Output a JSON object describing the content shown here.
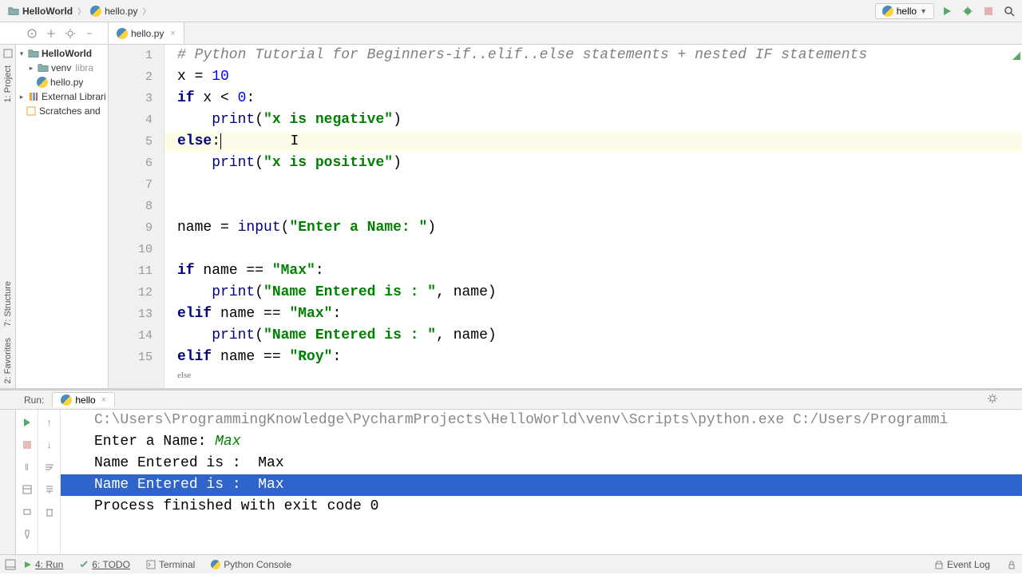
{
  "breadcrumb": {
    "project": "HelloWorld",
    "file": "hello.py"
  },
  "runConfig": {
    "name": "hello"
  },
  "tab": {
    "filename": "hello.py"
  },
  "tree": {
    "root": "HelloWorld",
    "venv": "venv",
    "venvSuffix": "libra",
    "hello": "hello.py",
    "ext": "External Librari",
    "scratch": "Scratches and"
  },
  "sideTabs": {
    "project": "1: Project",
    "structure": "7: Structure",
    "favorites": "2: Favorites"
  },
  "code": {
    "comment": "# Python Tutorial for Beginners-if..elif..else statements + nested IF statements",
    "x_assign_lhs": "x = ",
    "x_assign_val": "10",
    "if_kw": "if",
    "if_cond": " x < ",
    "zero": "0",
    "colon": ":",
    "print": "print",
    "str_neg": "\"x is negative\"",
    "else_kw": "else",
    "str_pos": "\"x is positive\"",
    "name_assign": "name = ",
    "input": "input",
    "str_prompt": "\"Enter a Name: \"",
    "if_name": " name == ",
    "str_max": "\"Max\"",
    "str_name_entered": "\"Name Entered is : \"",
    "comma_name": ", name)",
    "elif_kw": "elif",
    "str_roy": "\"Roy\"",
    "crumb": "else"
  },
  "run": {
    "title": "Run:",
    "tab": "hello",
    "line1": "C:\\Users\\ProgrammingKnowledge\\PycharmProjects\\HelloWorld\\venv\\Scripts\\python.exe C:/Users/Programmi",
    "prompt": "Enter a Name: ",
    "input": "Max",
    "out1": "Name Entered is :  Max",
    "out2": "Name Entered is :  Max",
    "exit": "Process finished with exit code 0"
  },
  "bottom": {
    "run": "4: Run",
    "todo": "6: TODO",
    "terminal": "Terminal",
    "pyconsole": "Python Console",
    "eventlog": "Event Log"
  }
}
